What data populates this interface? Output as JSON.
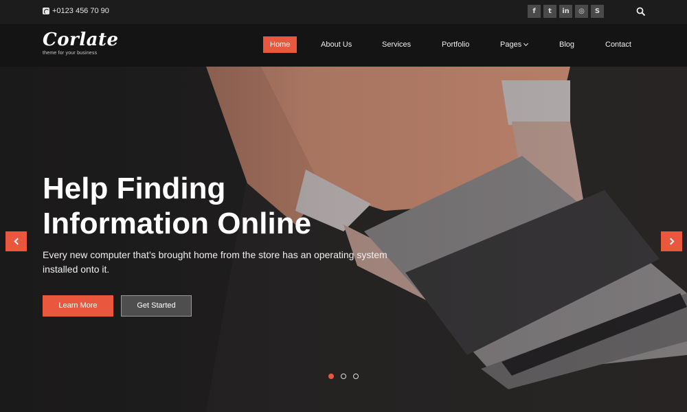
{
  "topbar": {
    "phone": "+0123 456 70 90",
    "phone_icon": "phone-icon",
    "socials": [
      {
        "icon": "facebook-icon",
        "glyph": "f"
      },
      {
        "icon": "twitter-icon",
        "glyph": "t"
      },
      {
        "icon": "linkedin-icon",
        "glyph": "in"
      },
      {
        "icon": "dribbble-icon",
        "glyph": "◎"
      },
      {
        "icon": "skype-icon",
        "glyph": "S"
      }
    ],
    "search_icon": "search-icon"
  },
  "logo": {
    "name": "Corlate",
    "tagline": "theme for your business"
  },
  "nav": {
    "items": [
      {
        "label": "Home",
        "active": true
      },
      {
        "label": "About Us"
      },
      {
        "label": "Services"
      },
      {
        "label": "Portfolio"
      },
      {
        "label": "Pages",
        "dropdown": true
      },
      {
        "label": "Blog"
      },
      {
        "label": "Contact"
      }
    ]
  },
  "hero": {
    "title_line1": "Help Finding",
    "title_line2": "Information Online",
    "description": "Every new computer that’s brought home from the store has an operating system installed onto it.",
    "primary_button": "Learn More",
    "secondary_button": "Get Started",
    "prev_icon": "chevron-left-icon",
    "next_icon": "chevron-right-icon",
    "slides": 3,
    "active_slide": 1
  },
  "colors": {
    "accent": "#e9573f",
    "topbar_bg": "#1c1c1c",
    "navbar_bg": "#141414"
  }
}
